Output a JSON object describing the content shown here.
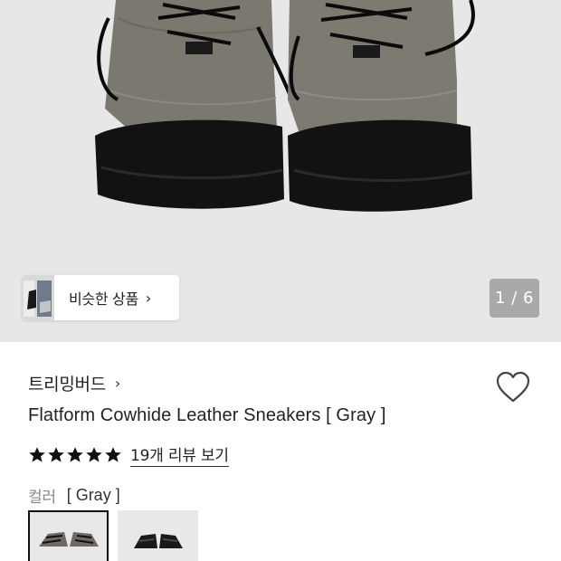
{
  "gallery": {
    "similar_label": "비슷한 상품",
    "similar_arrow": "›",
    "page_counter": "1 / 6",
    "current_image": 1,
    "total_images": 6
  },
  "product": {
    "brand": "트리밍버드",
    "brand_arrow": "›",
    "title": "Flatform Cowhide Leather Sneakers [ Gray ]",
    "rating_stars": 5,
    "review_link": "19개 리뷰 보기"
  },
  "option": {
    "label": "컬러",
    "value": "[ Gray ]",
    "swatches": [
      {
        "name": "gray",
        "selected": true
      },
      {
        "name": "black",
        "selected": false
      }
    ]
  },
  "colors": {
    "gallery_bg": "#e7e7e7",
    "shoe_upper": "#7b786f",
    "shoe_sole": "#111111",
    "star": "#111111"
  }
}
